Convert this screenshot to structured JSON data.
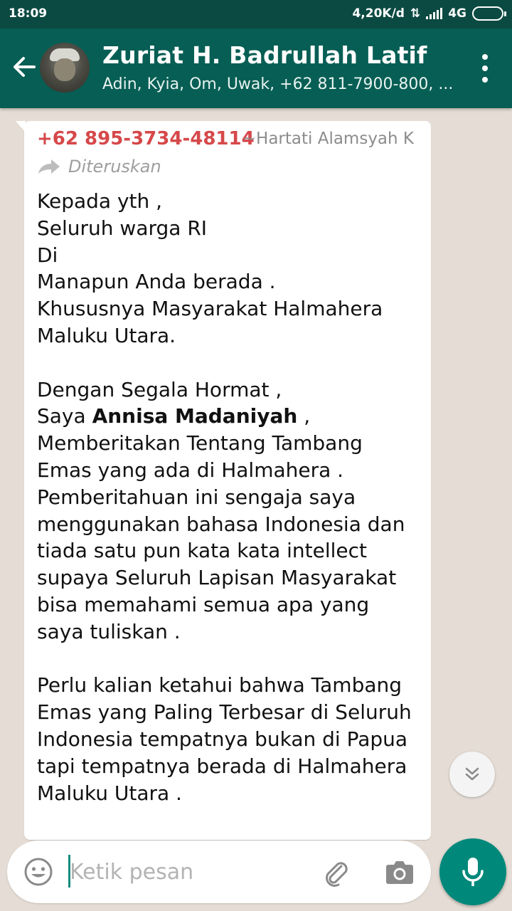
{
  "status_bar": {
    "time": "18:09",
    "speed": "4,20K/d",
    "network": "4G"
  },
  "header": {
    "title": "Zuriat H. Badrullah Latif",
    "subtitle": "Adin, Kyia, Om, Uwak, +62 811-7900-800, ..."
  },
  "message": {
    "sender_number": "+62 895-3734-48114",
    "sender_name": "~Hartati Alamsyah K",
    "forwarded_label": "Diteruskan",
    "lines": {
      "l1": "Kepada yth ,",
      "l2": "Seluruh warga RI",
      "l3": "Di",
      "l4": "Manapun Anda berada .",
      "l5": "Khususnya Masyarakat Halmahera",
      "l6": "Maluku Utara.",
      "l7": "Dengan Segala Hormat ,",
      "l8_pre": "Saya ",
      "l8_bold": "Annisa Madaniyah",
      "l8_post": " ,",
      "l9": "Memberitakan Tentang Tambang",
      "l10": "Emas yang ada di Halmahera .",
      "l11": "Pemberitahuan ini sengaja saya",
      "l12": "menggunakan bahasa Indonesia dan",
      "l13": "tiada satu pun kata kata intellect",
      "l14": "supaya Seluruh Lapisan Masyarakat",
      "l15": "bisa memahami semua apa yang",
      "l16": "saya tuliskan .",
      "l17": "Perlu kalian ketahui bahwa Tambang",
      "l18": "Emas yang Paling Terbesar di Seluruh",
      "l19": "Indonesia tempatnya bukan di Papua",
      "l20": "tapi tempatnya berada di Halmahera",
      "l21": "Maluku Utara ."
    }
  },
  "composer": {
    "placeholder": "Ketik pesan"
  },
  "icons": {
    "back": "arrow-left-icon",
    "menu": "more-vertical-icon",
    "forward": "forward-arrow-icon",
    "scroll": "chevron-double-down-icon",
    "emoji": "emoji-icon",
    "attach": "paperclip-icon",
    "camera": "camera-icon",
    "mic": "microphone-icon"
  },
  "colors": {
    "header": "#075e54",
    "status_bar": "#0b4a42",
    "sender": "#d6484a",
    "mic_button": "#00897b",
    "chat_background": "#e5ddd5"
  }
}
